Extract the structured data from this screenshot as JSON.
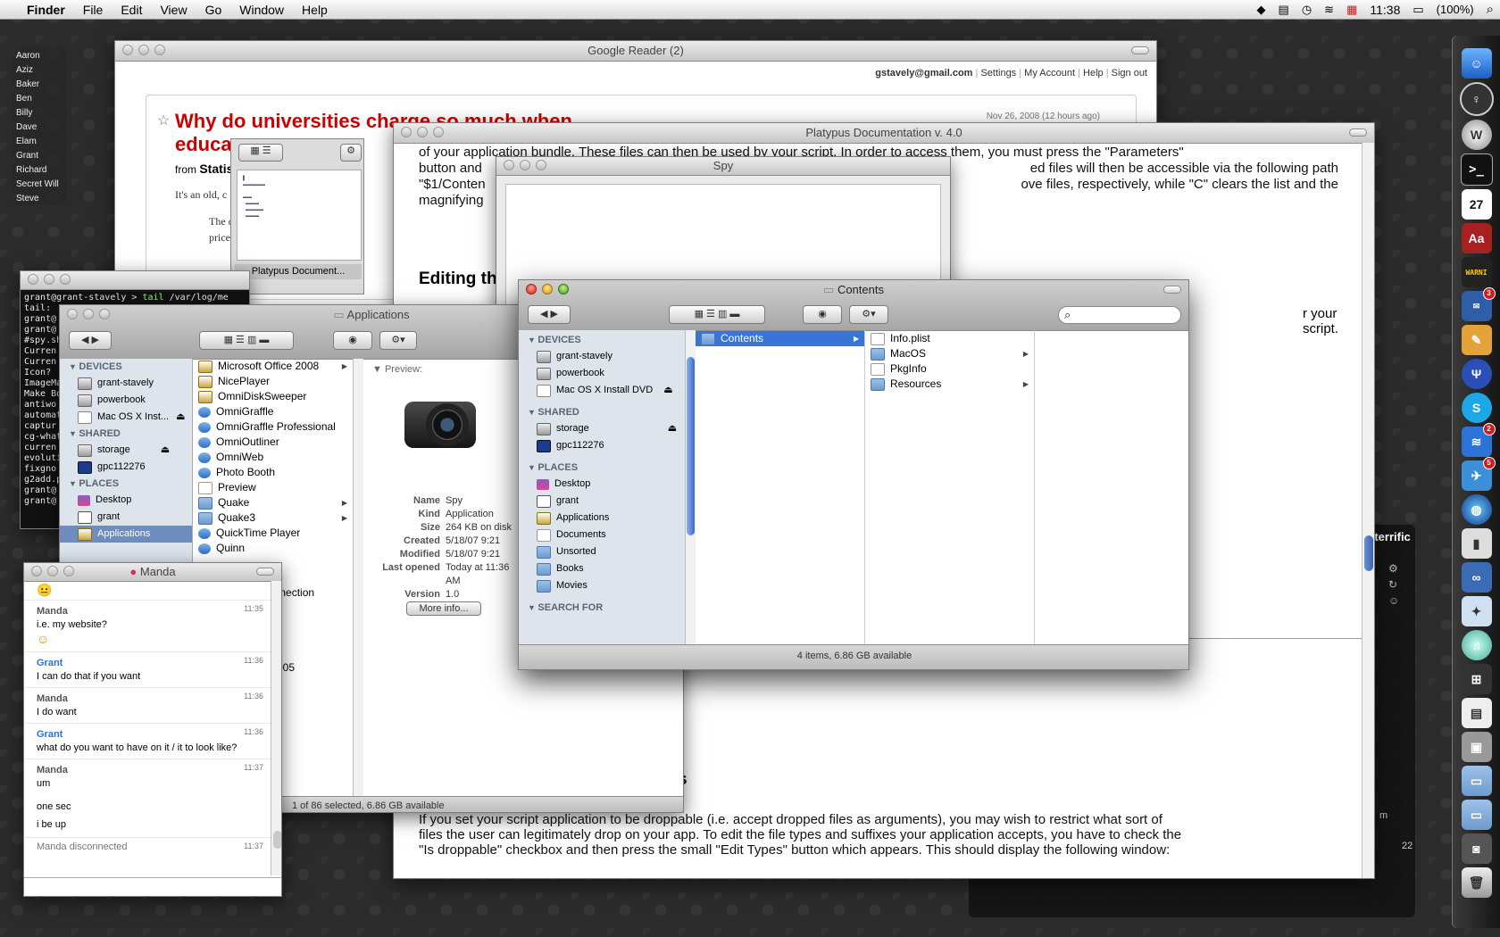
{
  "menubar": {
    "app": "Finder",
    "items": [
      "File",
      "Edit",
      "View",
      "Go",
      "Window",
      "Help"
    ],
    "clock": "11:38",
    "battery": "(100%)"
  },
  "buddies": [
    "Aaron",
    "Aziz",
    "Baker",
    "Ben",
    "Billy",
    "Dave",
    "Elam",
    "Grant",
    "Richard",
    "Secret Will",
    "Steve"
  ],
  "reader": {
    "title": "Google Reader (2)",
    "email": "gstavely@gmail.com",
    "links": [
      "Settings",
      "My Account",
      "Help",
      "Sign out"
    ],
    "headline1": "Why do universities charge so much when",
    "headline2": "educa",
    "from": "from",
    "source": "Statis",
    "date": "Nov 26, 2008 (12 hours ago)",
    "snippet": "It's an old, c",
    "snippet2": "The c",
    "snippet3": "price"
  },
  "platypus": {
    "title": "Platypus Documentation v. 4.0",
    "p1_l1": "of your application bundle. These files can then be used by your script. In order to access them, you must press the \"Parameters\"",
    "p1_l2": "button and",
    "p1_l2b": "ed files will then be accessible via the following path",
    "p1_l3": "\"$1/Conten",
    "p1_l3b": "ove files, respectively, while \"C\" clears the list and the",
    "p1_l4": "magnifying",
    "heading": "Editing th",
    "side_text": "r your script.",
    "bottom_heading": "s",
    "bp_l1": "If you set your script application to be droppable (i.e. accept dropped files as arguments), you may wish to restrict what sort of",
    "bp_l2": "files the user can legitimately drop on your app. To edit the file types and suffixes your application accepts, you have to check the",
    "bp_l3": "\"Is droppable\" checkbox and then press the small \"Edit Types\" button which appears. This should display the following window:",
    "thumb_label": "Platypus Document..."
  },
  "spy": {
    "title": "Spy"
  },
  "terminal": {
    "prompt_user": "grant@grant-stavely",
    "prompt_sep": " > ",
    "cmd": "tail",
    "cmd_arg": " /var/log/me",
    "lines": [
      "tail: ",
      "grant@",
      "grant@",
      "#spy.sh",
      "Curren",
      "Curren",
      "Icon?",
      "ImageMa",
      "Make Bo",
      "antiwo",
      "automat",
      "captur",
      "cg-what",
      "curren",
      "evoluti",
      "fixgno",
      "g2add.p",
      "grant@",
      "grant@"
    ]
  },
  "applications": {
    "title": "Applications",
    "sidebar": {
      "devices_label": "DEVICES",
      "devices": [
        "grant-stavely",
        "powerbook",
        "Mac OS X Inst..."
      ],
      "shared_label": "SHARED",
      "shared": [
        "storage",
        "gpc112276"
      ],
      "places_label": "PLACES",
      "places": [
        "Desktop",
        "grant",
        "Applications"
      ]
    },
    "list": [
      "Microsoft Office 2008",
      "NicePlayer",
      "OmniDiskSweeper",
      "OmniGraffle",
      "OmniGraffle Professional",
      "OmniOutliner",
      "OmniWeb",
      "Photo Booth",
      "Preview",
      "Quake",
      "Quake3",
      "QuickTime Player",
      "Quinn"
    ],
    "list_more": [
      "top",
      "onnection",
      ".2005"
    ],
    "preview_label": "Preview:",
    "info": [
      {
        "k": "Name",
        "v": "Spy"
      },
      {
        "k": "Kind",
        "v": "Application"
      },
      {
        "k": "Size",
        "v": "264 KB on disk"
      },
      {
        "k": "Created",
        "v": "5/18/07 9:21"
      },
      {
        "k": "Modified",
        "v": "5/18/07 9:21"
      },
      {
        "k": "Last opened",
        "v": "Today at 11:36"
      },
      {
        "k": "",
        "v": "AM"
      },
      {
        "k": "Version",
        "v": "1.0"
      }
    ],
    "more_info": "More info...",
    "status": "1 of 86 selected, 6.86 GB available"
  },
  "chat": {
    "title": "Manda",
    "messages": [
      {
        "name": "Manda",
        "time": "11:35",
        "text": "i.e. my website?"
      },
      {
        "name": "Grant",
        "time": "11:36",
        "text": "I can do that if you want"
      },
      {
        "name": "Manda",
        "time": "11:36",
        "text": "I do want"
      },
      {
        "name": "Grant",
        "time": "11:36",
        "text": "what do you want to have on it / it to look like?"
      },
      {
        "name": "Manda",
        "time": "11:37",
        "text": "um"
      }
    ],
    "extra1": "one sec",
    "extra2": "i be up",
    "disconnected": "Manda disconnected",
    "disconnected_time": "11:37"
  },
  "contents": {
    "title": "Contents",
    "search_placeholder": "",
    "sidebar": {
      "devices_label": "DEVICES",
      "devices": [
        "grant-stavely",
        "powerbook",
        "Mac OS X Install DVD"
      ],
      "shared_label": "SHARED",
      "shared": [
        "storage",
        "gpc112276"
      ],
      "places_label": "PLACES",
      "places": [
        "Desktop",
        "grant",
        "Applications",
        "Documents",
        "Unsorted",
        "Books",
        "Movies"
      ],
      "search_label": "SEARCH FOR"
    },
    "col1": [
      "Contents"
    ],
    "col2": [
      "Info.plist",
      "MacOS",
      "PkgInfo",
      "Resources"
    ],
    "status": "4 items, 6.86 GB available"
  },
  "bgwidget": {
    "label": "tterrific",
    "num": "22",
    "m": "m"
  },
  "dock": {
    "badges": {
      "mail": "3",
      "rss": "2",
      "misc": "5"
    },
    "calendar_day": "27",
    "console_text": "WARNI"
  },
  "colors": {
    "accent": "#3875d7",
    "headline": "#cc0000"
  }
}
